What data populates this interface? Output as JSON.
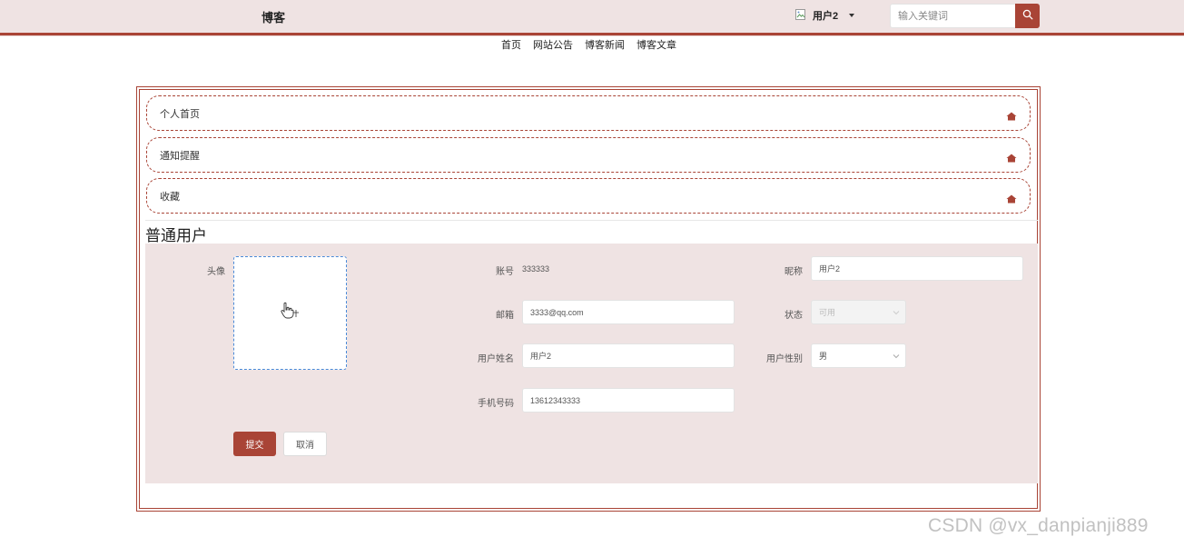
{
  "header": {
    "site_title": "博客",
    "user_name": "用户2",
    "search_placeholder": "输入关键词"
  },
  "nav": {
    "items": [
      "首页",
      "网站公告",
      "博客新闻",
      "博客文章"
    ]
  },
  "menu": {
    "items": [
      {
        "label": "个人首页"
      },
      {
        "label": "通知提醒"
      },
      {
        "label": "收藏"
      }
    ]
  },
  "section_title": "普通用户",
  "form": {
    "avatar_label": "头像",
    "account_label": "账号",
    "account_value": "333333",
    "nickname_label": "昵称",
    "nickname_value": "用户2",
    "email_label": "邮箱",
    "email_value": "3333@qq.com",
    "status_label": "状态",
    "status_value": "可用",
    "realname_label": "用户姓名",
    "realname_value": "用户2",
    "gender_label": "用户性别",
    "gender_value": "男",
    "phone_label": "手机号码",
    "phone_value": "13612343333",
    "submit_label": "提交",
    "cancel_label": "取消"
  },
  "watermark": "CSDN @vx_danpianji889",
  "colors": {
    "accent": "#a94436",
    "header_bg": "#efe3e3",
    "form_bg": "#efe3e3",
    "upload_border": "#4a8ad8"
  }
}
